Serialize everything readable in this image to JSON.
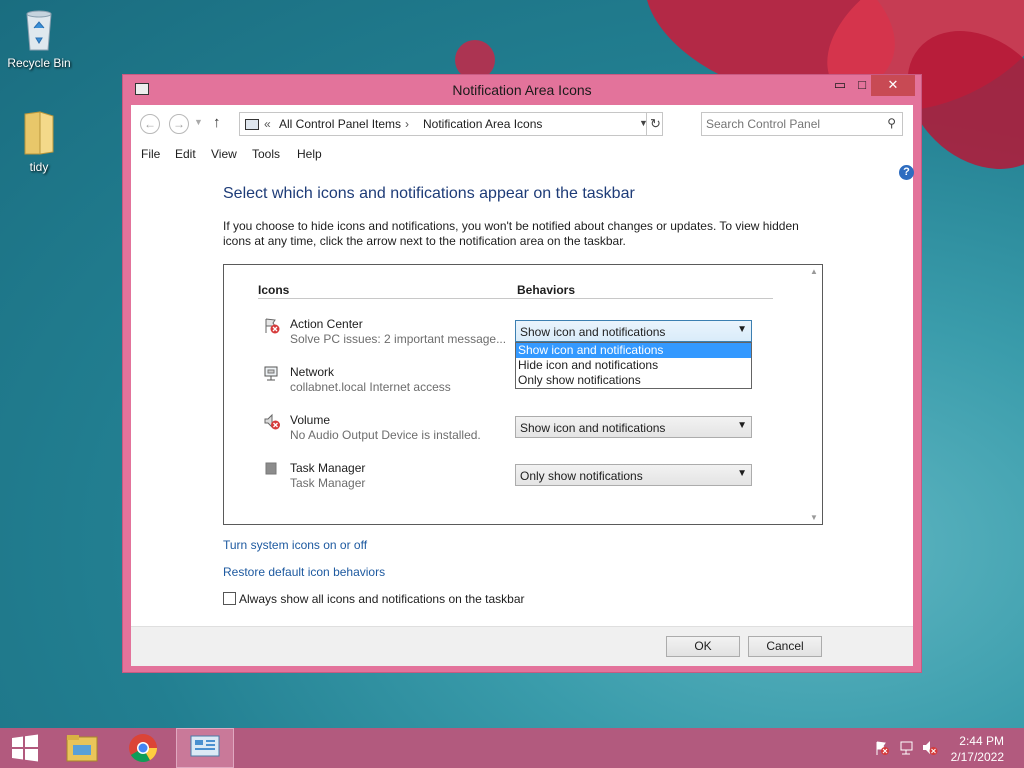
{
  "desktop": {
    "icons": [
      {
        "label": "Recycle Bin"
      },
      {
        "label": "tidy"
      }
    ]
  },
  "window": {
    "title": "Notification Area Icons",
    "controls": {
      "minimize": "▭",
      "maximize": "□",
      "close": "✕"
    }
  },
  "address": {
    "prefix": "«",
    "crumbs": [
      "All Control Panel Items",
      "Notification Area Icons"
    ],
    "search_placeholder": "Search Control Panel"
  },
  "menu": [
    "File",
    "Edit",
    "View",
    "Tools",
    "Help"
  ],
  "main": {
    "heading": "Select which icons and notifications appear on the taskbar",
    "description": "If you choose to hide icons and notifications, you won't be notified about changes or updates. To view hidden icons at any time, click the arrow next to the notification area on the taskbar.",
    "columns": {
      "icons": "Icons",
      "behaviors": "Behaviors"
    },
    "rows": [
      {
        "name": "Action Center",
        "desc": "Solve PC issues: 2 important message...",
        "behavior": "Show icon and notifications",
        "icon": "action-center-flag-icon"
      },
      {
        "name": "Network",
        "desc": "collabnet.local Internet access",
        "behavior": "",
        "icon": "network-icon"
      },
      {
        "name": "Volume",
        "desc": "No Audio Output Device is installed.",
        "behavior": "Show icon and notifications",
        "icon": "volume-muted-icon"
      },
      {
        "name": "Task Manager",
        "desc": "Task Manager",
        "behavior": "Only show notifications",
        "icon": "task-manager-icon"
      }
    ],
    "dropdown_options": [
      "Show icon and notifications",
      "Hide icon and notifications",
      "Only show notifications"
    ],
    "dropdown_selected_index": 0,
    "links": {
      "system_icons": "Turn system icons on or off",
      "restore": "Restore default icon behaviors"
    },
    "checkbox": {
      "label": "Always show all icons and notifications on the taskbar",
      "checked": false
    }
  },
  "footer": {
    "ok": "OK",
    "cancel": "Cancel"
  },
  "taskbar": {
    "time": "2:44 PM",
    "date": "2/17/2022"
  },
  "colors": {
    "window_frame": "#e3739b",
    "taskbar": "#b25a7e",
    "link": "#1e5aa0",
    "heading": "#1e3c78",
    "selection": "#3399ff"
  }
}
